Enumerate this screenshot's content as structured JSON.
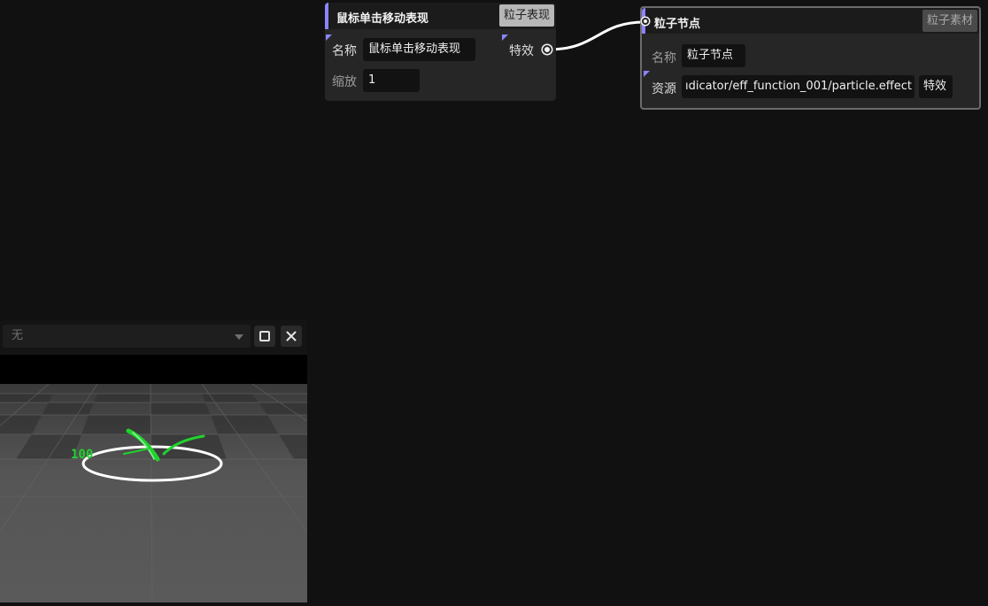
{
  "node_click": {
    "title": "鼠标单击移动表现",
    "tag": "粒子表现",
    "name_label": "名称",
    "name_value": "鼠标单击移动表现",
    "scale_label": "缩放",
    "scale_value": "1",
    "effect_label": "特效"
  },
  "node_particle": {
    "title": "粒子节点",
    "tag": "粒子素材",
    "name_label": "名称",
    "name_value": "粒子节点",
    "resource_label": "资源",
    "resource_value": "ıdicator/eff_function_001/particle.effect",
    "effect_label": "特效"
  },
  "preview": {
    "selected": "无",
    "scene_label": "100"
  },
  "colors": {
    "accent": "#8a84ff",
    "background": "#111111",
    "node": "#262626",
    "effect_green": "#22d22e"
  },
  "icons": {
    "maximize": "square-outline-icon",
    "close": "close-x-icon",
    "dropdown": "chevron-down-icon"
  }
}
